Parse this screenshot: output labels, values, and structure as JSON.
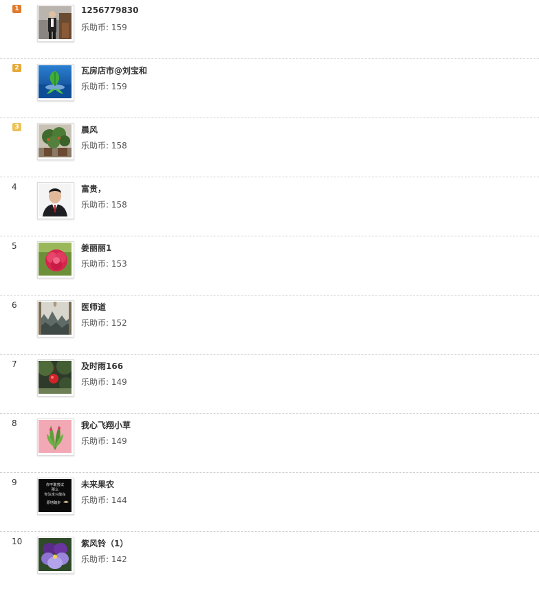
{
  "leaderboard": {
    "coin_label": "乐助币:",
    "rank_colors": {
      "1": "#e07b2d",
      "2": "#e6a93a",
      "3": "#ecc257"
    },
    "entries": [
      {
        "rank": "1",
        "name": "1256779830",
        "coins": "159",
        "avatar": "man-standing-photo"
      },
      {
        "rank": "2",
        "name": "瓦房店市@刘宝和",
        "coins": "159",
        "avatar": "green-leaf-water-photo"
      },
      {
        "rank": "3",
        "name": "晨风",
        "coins": "158",
        "avatar": "potted-tree-photo"
      },
      {
        "rank": "4",
        "name": "富贵，",
        "coins": "158",
        "avatar": "portrait-photo"
      },
      {
        "rank": "5",
        "name": "姜丽丽1",
        "coins": "153",
        "avatar": "pink-flower-photo"
      },
      {
        "rank": "6",
        "name": "医师道",
        "coins": "152",
        "avatar": "mountain-painting-photo"
      },
      {
        "rank": "7",
        "name": "及时雨166",
        "coins": "149",
        "avatar": "red-fruit-photo"
      },
      {
        "rank": "8",
        "name": "我心飞翔小草",
        "coins": "149",
        "avatar": "plant-pink-background-photo"
      },
      {
        "rank": "9",
        "name": "未来果农",
        "coins": "144",
        "avatar": "black-text-card",
        "avatar_text": [
          "你不敢尝试",
          "那么",
          "你注定只能在",
          "原地踏步"
        ]
      },
      {
        "rank": "10",
        "name": "紫风铃（1）",
        "coins": "142",
        "avatar": "purple-pansy-photo"
      }
    ]
  }
}
